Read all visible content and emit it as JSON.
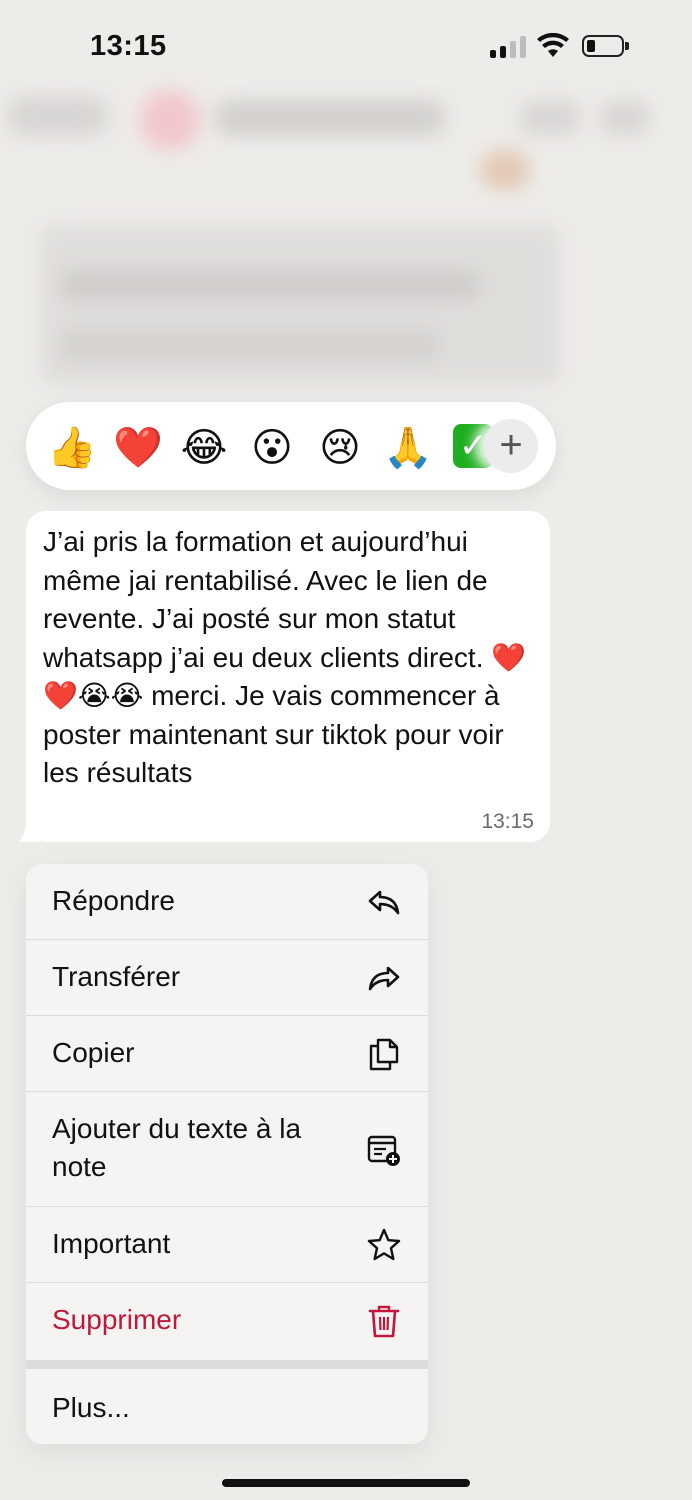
{
  "status_bar": {
    "time": "13:15"
  },
  "reactions": {
    "items": [
      "👍",
      "❤️",
      "😂",
      "😮",
      "😢",
      "🙏",
      "✅"
    ],
    "more_label": "+"
  },
  "message": {
    "text": "J’ai pris la formation et aujourd’hui même jai rentabilisé. Avec le lien de revente. J’ai posté sur mon statut whatsapp j’ai eu deux clients direct. ❤️❤️😭😭 merci. Je vais commencer à poster maintenant sur tiktok pour voir les résultats",
    "time": "13:15"
  },
  "menu": {
    "items": [
      {
        "label": "Répondre",
        "icon": "reply-icon"
      },
      {
        "label": "Transférer",
        "icon": "forward-icon"
      },
      {
        "label": "Copier",
        "icon": "copy-icon"
      },
      {
        "label": "Ajouter du texte à la note",
        "icon": "add-to-note-icon"
      },
      {
        "label": "Important",
        "icon": "star-icon"
      },
      {
        "label": "Supprimer",
        "icon": "trash-icon",
        "color": "#c0183a"
      }
    ],
    "more_label": "Plus..."
  }
}
